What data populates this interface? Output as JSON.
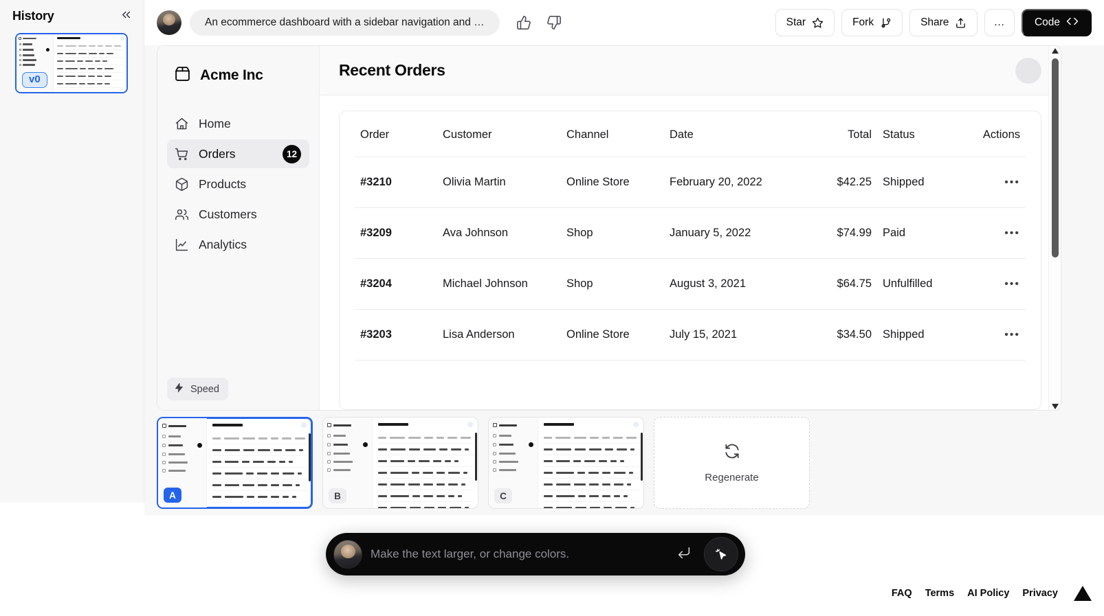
{
  "history": {
    "title": "History",
    "collapse_icon": "chevron-double-left-icon",
    "version_label": "v0"
  },
  "topbar": {
    "prompt": "An ecommerce dashboard with a sidebar navigation and …",
    "thumbs_up_icon": "thumbs-up-icon",
    "thumbs_down_icon": "thumbs-down-icon",
    "buttons": {
      "star": "Star",
      "fork": "Fork",
      "share": "Share",
      "more": "…",
      "code": "Code"
    }
  },
  "app": {
    "brand": "Acme Inc",
    "brand_icon": "package-icon",
    "nav": [
      {
        "label": "Home",
        "icon": "home-icon",
        "badge": "",
        "active": false
      },
      {
        "label": "Orders",
        "icon": "cart-icon",
        "badge": "12",
        "active": true
      },
      {
        "label": "Products",
        "icon": "box-icon",
        "badge": "",
        "active": false
      },
      {
        "label": "Customers",
        "icon": "users-icon",
        "badge": "",
        "active": false
      },
      {
        "label": "Analytics",
        "icon": "chart-line-icon",
        "badge": "",
        "active": false
      }
    ],
    "speed_label": "Speed",
    "speed_icon": "bolt-icon",
    "page_title": "Recent Orders",
    "table": {
      "columns": [
        "Order",
        "Customer",
        "Channel",
        "Date",
        "Total",
        "Status",
        "Actions"
      ],
      "rows": [
        {
          "order": "#3210",
          "customer": "Olivia Martin",
          "channel": "Online Store",
          "date": "February 20, 2022",
          "total": "$42.25",
          "status": "Shipped",
          "actions": "•••"
        },
        {
          "order": "#3209",
          "customer": "Ava Johnson",
          "channel": "Shop",
          "date": "January 5, 2022",
          "total": "$74.99",
          "status": "Paid",
          "actions": "•••"
        },
        {
          "order": "#3204",
          "customer": "Michael Johnson",
          "channel": "Shop",
          "date": "August 3, 2021",
          "total": "$64.75",
          "status": "Unfulfilled",
          "actions": "•••"
        },
        {
          "order": "#3203",
          "customer": "Lisa Anderson",
          "channel": "Online Store",
          "date": "July 15, 2021",
          "total": "$34.50",
          "status": "Shipped",
          "actions": "•••"
        }
      ]
    }
  },
  "variants": [
    {
      "label": "A",
      "selected": true
    },
    {
      "label": "B",
      "selected": false
    },
    {
      "label": "C",
      "selected": false
    }
  ],
  "regenerate": {
    "label": "Regenerate",
    "icon": "refresh-icon"
  },
  "chat": {
    "placeholder": "Make the text larger, or change colors.",
    "value": "",
    "submit_icon": "enter-return-icon",
    "cursor_icon": "sparkle-cursor-icon"
  },
  "footer": {
    "links": [
      "FAQ",
      "Terms",
      "AI Policy",
      "Privacy"
    ],
    "logo": "vercel-triangle-logo"
  },
  "colors": {
    "accent_blue": "#2563eb",
    "dark": "#0a0a0a",
    "panel_bg": "#f7f7f8"
  }
}
